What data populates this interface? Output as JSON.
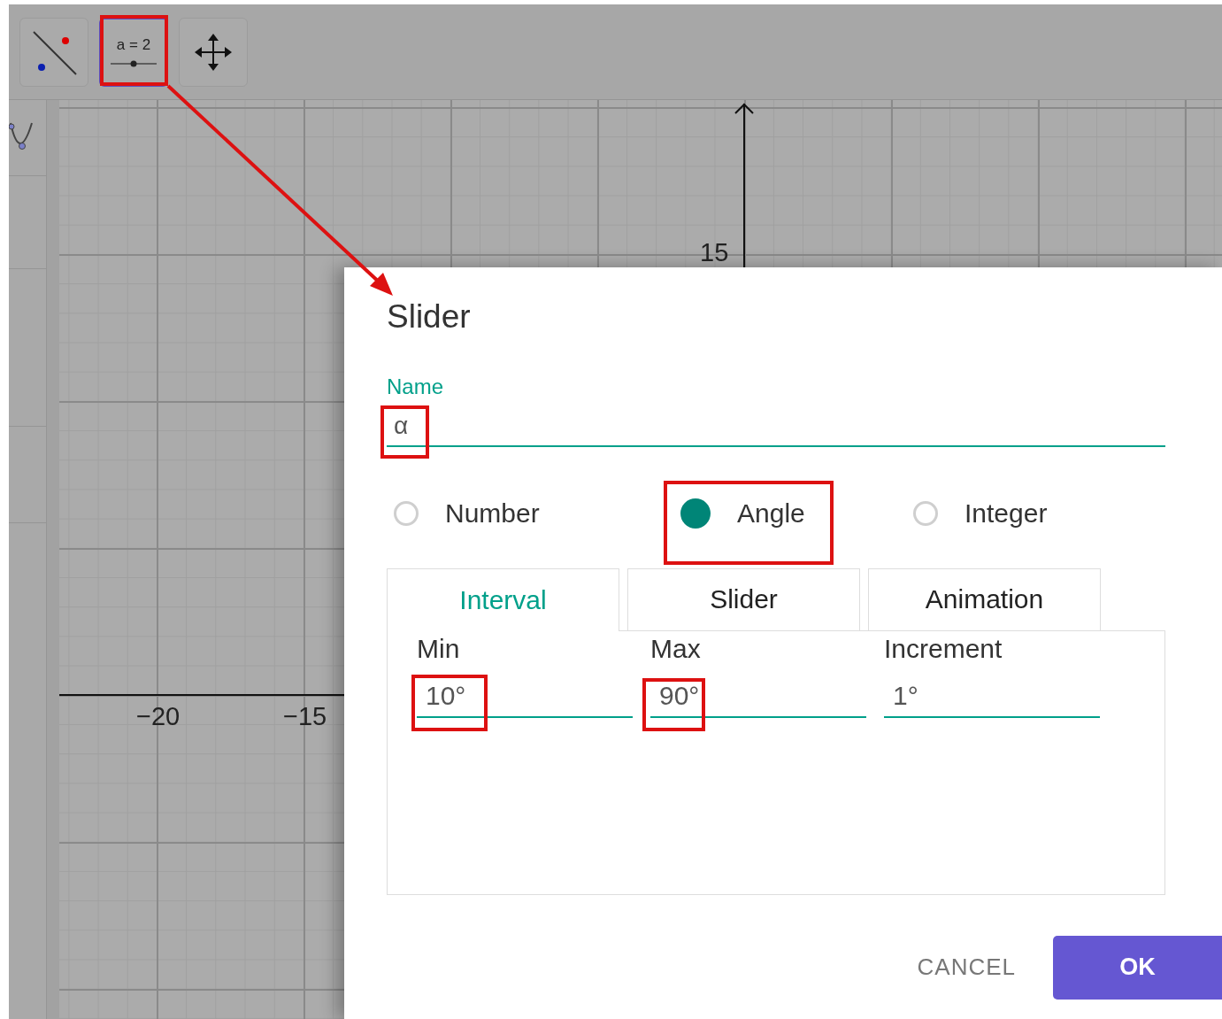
{
  "toolbar": {
    "tools": [
      {
        "kind": "line",
        "selected": false
      },
      {
        "kind": "slider",
        "label": "a = 2",
        "selected": true
      },
      {
        "kind": "move",
        "selected": false
      }
    ]
  },
  "graph": {
    "x_ticks": [
      "−20",
      "−15"
    ],
    "y_ticks": [
      "15"
    ]
  },
  "dialog": {
    "title": "Slider",
    "name_label": "Name",
    "name_value": "α",
    "types": [
      {
        "label": "Number",
        "selected": false
      },
      {
        "label": "Angle",
        "selected": true
      },
      {
        "label": "Integer",
        "selected": false
      }
    ],
    "tabs": [
      {
        "label": "Interval",
        "selected": true
      },
      {
        "label": "Slider",
        "selected": false
      },
      {
        "label": "Animation",
        "selected": false
      }
    ],
    "fields": [
      {
        "label": "Min",
        "value": "10°"
      },
      {
        "label": "Max",
        "value": "90°"
      },
      {
        "label": "Increment",
        "value": "1°"
      }
    ],
    "cancel": "CANCEL",
    "ok": "OK"
  }
}
